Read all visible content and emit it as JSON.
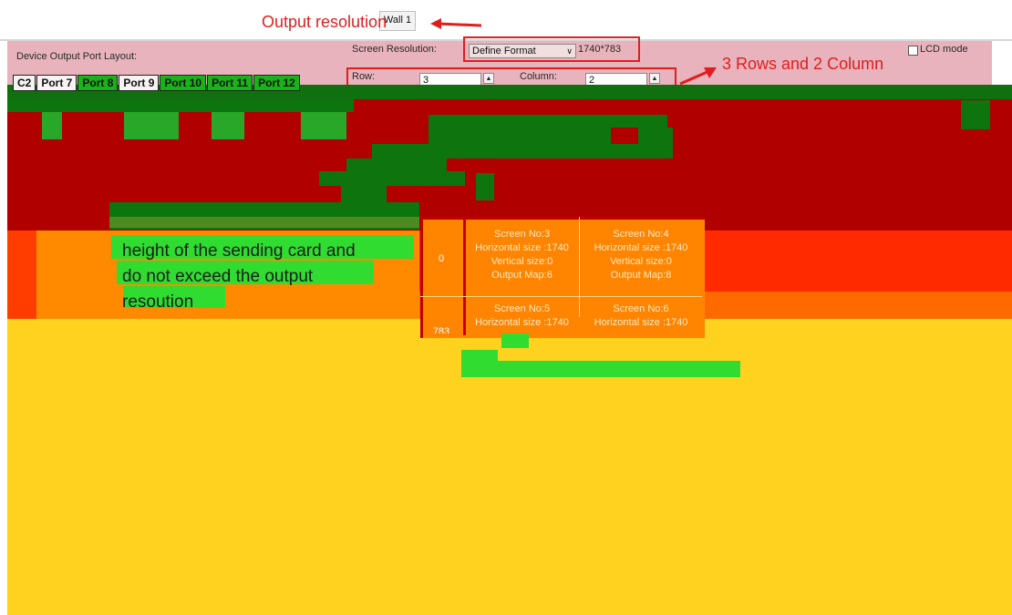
{
  "window": {
    "tab_label": "Wall 1"
  },
  "header": {
    "port_layout_label": "Device Output Port Layout:",
    "screen_resolution_label": "Screen Resolution:",
    "format_select_value": "Define Format",
    "resolution_value": "1740*783",
    "lcd_mode_label": "LCD mode",
    "row_label": "Row:",
    "row_value": "3",
    "column_label": "Column:",
    "column_value": "2"
  },
  "ports": [
    "C2",
    "Port 7",
    "Port 8",
    "Port 9",
    "Port 10",
    "Port 11",
    "Port 12"
  ],
  "annotations": {
    "output_resolution": "Output resolution",
    "rows_columns": "3 Rows and 2 Column",
    "note": "height of the sending card and\ndo not exceed the output\nresoution"
  },
  "grid": {
    "row_labels": [
      "0",
      "783"
    ],
    "cells": [
      {
        "screen": "Screen No:3",
        "hsize": "Horizontal size :1740",
        "vsize": "Vertical size:0",
        "map": "Output Map:6"
      },
      {
        "screen": "Screen No:4",
        "hsize": "Horizontal size :1740",
        "vsize": "Vertical size:0",
        "map": "Output Map:8"
      },
      {
        "screen": "Screen No:5",
        "hsize": "Horizontal size :1740"
      },
      {
        "screen": "Screen No:6",
        "hsize": "Horizontal size :1740"
      }
    ]
  },
  "colors": {
    "dark_red": "#b00000",
    "red": "#ff2a00",
    "orange": "#ff8400",
    "yellow": "#ffd21f",
    "green": "#1ab21a",
    "annotation_red": "#e01e1e"
  }
}
